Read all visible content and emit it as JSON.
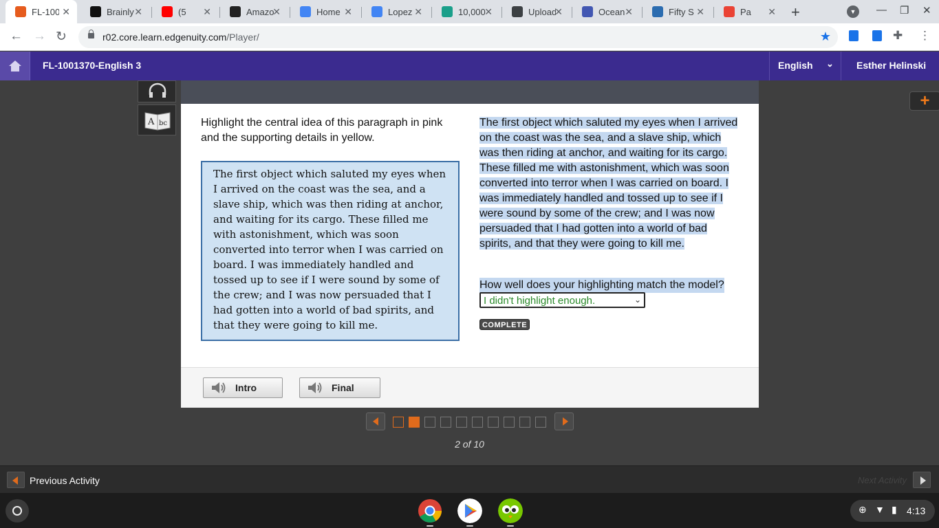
{
  "browser": {
    "tabs": [
      {
        "title": "FL-100",
        "icon": "edgenuity-icon",
        "color": "#e65c1e",
        "active": true
      },
      {
        "title": "Brainly",
        "icon": "brainly-icon",
        "color": "#111111"
      },
      {
        "title": "(5",
        "icon": "youtube-icon",
        "color": "#ff0000"
      },
      {
        "title": "Amazo",
        "icon": "amazon-icon",
        "color": "#222222"
      },
      {
        "title": "Home",
        "icon": "classlink-icon",
        "color": "#4285f4"
      },
      {
        "title": "Lopez",
        "icon": "classlink-icon",
        "color": "#4285f4"
      },
      {
        "title": "10,000",
        "icon": "docs-icon",
        "color": "#1a9f8a"
      },
      {
        "title": "Upload",
        "icon": "quizlet-layers-icon",
        "color": "#3c4043"
      },
      {
        "title": "Ocean",
        "icon": "quizlet-icon",
        "color": "#4257b2"
      },
      {
        "title": "Fifty S",
        "icon": "film-reel-icon",
        "color": "#2b6cb0"
      },
      {
        "title": "Pa",
        "icon": "gmail-icon",
        "color": "#ea4335"
      }
    ],
    "url_host": "r02.core.learn.edgenuity.com",
    "url_path": "/Player/"
  },
  "header": {
    "course": "FL-1001370-English 3",
    "language": "English",
    "user": "Esther Helinski"
  },
  "activity": {
    "instructions": "Highlight the central idea of this paragraph in pink and the supporting details in yellow.",
    "passage": "The first object which saluted my eyes when I arrived on the coast was the sea, and a slave ship, which was then riding at anchor, and waiting for its cargo. These filled me with astonishment, which was soon converted into terror when I was carried on board. I was immediately handled and tossed up to see if I were sound by some of the crew; and I was now persuaded that I had gotten into a world of bad spirits, and that they were going to kill me.",
    "model_text": "The first object which saluted my eyes when I arrived on the coast was the sea, and a slave ship, which was then riding at anchor, and waiting for its cargo. These filled me with astonishment, which was soon converted into terror when I was carried on board. I was immediately handled and tossed up to see if I were sound by some of the crew; and I was now persuaded that I had gotten into a world of bad spirits, and that they were going to kill me.",
    "question": "How well does your highlighting match the model?",
    "selected_answer": "I didn't highlight enough.",
    "complete_label": "COMPLETE",
    "intro_label": "Intro",
    "final_label": "Final"
  },
  "pager": {
    "current": 2,
    "total": 10,
    "label": "2 of 10"
  },
  "nav": {
    "previous_label": "Previous Activity",
    "next_label": "Next Activity"
  },
  "tray": {
    "time": "4:13"
  }
}
